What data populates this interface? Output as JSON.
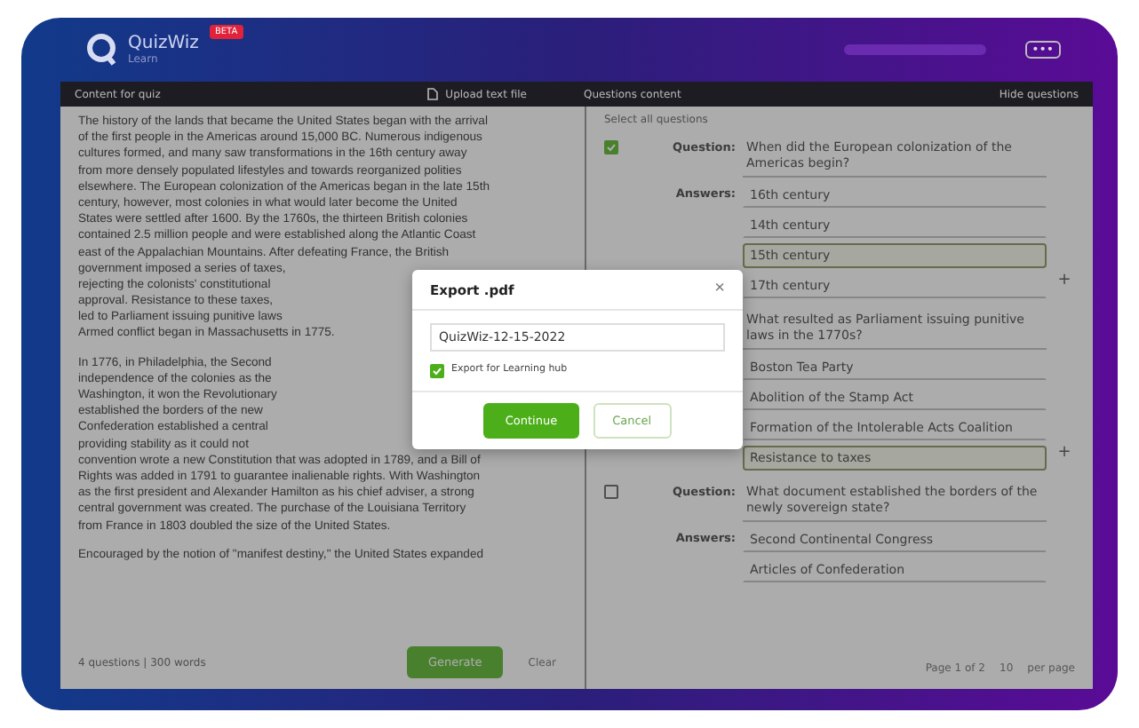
{
  "header": {
    "logo": "QuizWiz",
    "badge": "BETA",
    "tagline": "Learn",
    "menu": "•••"
  },
  "toolbar": {
    "left_title": "Content for quiz",
    "upload": "Upload text file",
    "right_title": "Questions content",
    "toggle": "Hide questions"
  },
  "passage": [
    {
      "lines": [
        "The history of the lands that became the United States began with the arrival",
        "of the first people in the Americas around 15,000 BC. Numerous indigenous",
        "cultures formed, and many saw transformations in the 16th century away",
        "from more densely populated lifestyles and towards reorganized polities",
        "elsewhere. The European colonization of the Americas began in the late 15th",
        "century, however, most colonies in what would later become the United",
        "States were settled after 1600. By the 1760s, the thirteen British colonies",
        "contained 2.5 million people and were established along the Atlantic Coast",
        "east of the Appalachian Mountains. After defeating France, the British",
        "government imposed a series of taxes,",
        "rejecting the colonists' constitutional",
        "approval. Resistance to these taxes,",
        "led to Parliament issuing punitive laws",
        "Armed conflict began in Massachusetts in 1775."
      ]
    },
    {
      "lines": [
        "In 1776, in Philadelphia, the Second",
        "independence of the colonies as the",
        "Washington, it won the Revolutionary",
        "established the borders of the new",
        "Confederation established a central",
        "providing stability as it could not",
        "convention wrote a new Constitution that was adopted in 1789, and a Bill of",
        "Rights was added in 1791 to guarantee inalienable rights. With Washington",
        "as the first president and Alexander Hamilton as his chief adviser, a strong",
        "central government was created. The purchase of the Louisiana Territory",
        "from France in 1803 doubled the size of the United States."
      ]
    },
    {
      "lines": [
        "Encouraged by the notion of \"manifest destiny,\" the United States expanded"
      ]
    }
  ],
  "footer_left": {
    "stats": "4 questions | 300 words",
    "generate": "Generate",
    "clear": "Clear"
  },
  "select_all": "Select all questions",
  "questions": [
    {
      "checked": true,
      "question_label": "Question:",
      "question": "When did the European colonization of the Americas begin?",
      "answer_label": "Answers:",
      "add": "+",
      "answers": [
        {
          "text": "16th century",
          "selected": false
        },
        {
          "text": "14th century",
          "selected": false
        },
        {
          "text": "15th century",
          "selected": true
        },
        {
          "text": "17th century",
          "selected": false
        }
      ]
    },
    {
      "question": "What resulted as Parliament issuing punitive laws in the 1770s?",
      "add": "+",
      "answers": [
        {
          "text": "Boston Tea Party",
          "selected": false
        },
        {
          "text": "Abolition of the Stamp Act",
          "selected": false
        },
        {
          "text": "Formation of the Intolerable Acts Coalition",
          "selected": false
        },
        {
          "text": "Resistance to taxes",
          "selected": true
        }
      ]
    },
    {
      "checked": false,
      "question_label": "Question:",
      "question": "What document established the borders of the newly sovereign state?",
      "answer_label": "Answers:",
      "answers": [
        {
          "text": "Second Continental Congress",
          "selected": false
        },
        {
          "text": "Articles of Confederation",
          "selected": false
        }
      ]
    }
  ],
  "pager": {
    "info": "Page 1 of 2",
    "per_page": "10",
    "label": "per page"
  },
  "dialog": {
    "title": "Export .pdf",
    "close": "×",
    "filename": "QuizWiz-12-15-2022",
    "option": {
      "label": "Export for Learning hub",
      "checked": true
    },
    "confirm": "Continue",
    "cancel": "Cancel"
  }
}
